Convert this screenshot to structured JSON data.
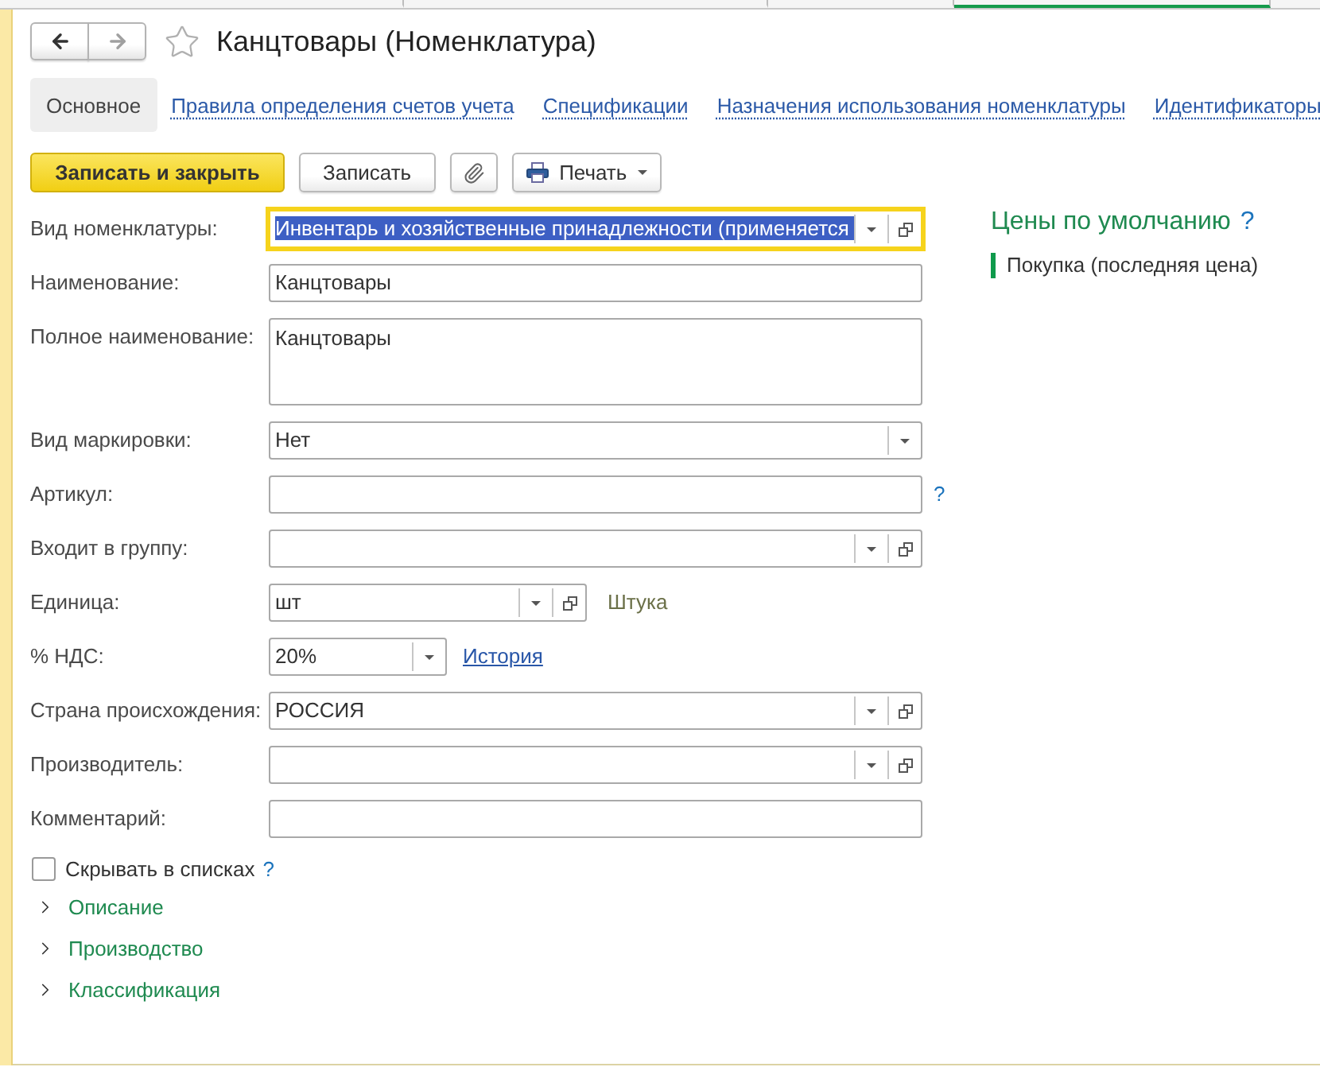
{
  "window_tabs": [
    {
      "selected": false
    },
    {
      "selected": false
    },
    {
      "selected": false
    },
    {
      "selected": true
    }
  ],
  "header": {
    "back_disabled": false,
    "forward_disabled": true,
    "favorite": false,
    "title": "Канцтовары (Номенклатура)"
  },
  "tabs": [
    {
      "label": "Основное",
      "selected": true
    },
    {
      "label": "Правила определения счетов учета",
      "selected": false
    },
    {
      "label": "Спецификации",
      "selected": false
    },
    {
      "label": "Назначения использования номенклатуры",
      "selected": false
    },
    {
      "label": "Идентификаторы",
      "selected": false
    }
  ],
  "toolbar": [
    {
      "kind": "primary",
      "label": "Записать и закрыть"
    },
    {
      "kind": "default",
      "label": "Записать"
    },
    {
      "kind": "attach"
    },
    {
      "kind": "menu",
      "label": "Печать"
    }
  ],
  "fields": [
    {
      "label": "Вид номенклатуры:",
      "kind": "select",
      "value": "Инвентарь и хозяйственные принадлежности (применяется",
      "open_button": true,
      "focused": true
    },
    {
      "label": "Наименование:",
      "kind": "text",
      "value": "Канцтовары",
      "focused": false
    },
    {
      "label": "Полное наименование:",
      "kind": "textarea",
      "value": "Канцтовары",
      "focused": false
    },
    {
      "label": "Вид маркировки:",
      "kind": "select",
      "value": "Нет",
      "open_button": false,
      "focused": false
    },
    {
      "label": "Артикул:",
      "kind": "text",
      "focused": false,
      "help": "?"
    },
    {
      "label": "Входит в группу:",
      "kind": "select",
      "open_button": true,
      "focused": false
    },
    {
      "label": "Единица:",
      "kind": "select",
      "value": "шт",
      "open_button": true,
      "focused": false,
      "note": "Штука"
    },
    {
      "label": "% НДС:",
      "kind": "select",
      "value": "20%",
      "open_button": false,
      "focused": false,
      "link": "История"
    },
    {
      "label": "Страна происхождения:",
      "kind": "select",
      "value": "РОССИЯ",
      "open_button": true,
      "focused": false
    },
    {
      "label": "Производитель:",
      "kind": "select",
      "open_button": true,
      "focused": false
    },
    {
      "label": "Комментарий:",
      "kind": "text",
      "focused": false
    }
  ],
  "checkbox": {
    "label": "Скрывать в списках",
    "checked": false,
    "help": "?"
  },
  "groups": [
    {
      "label": "Описание",
      "expanded": false
    },
    {
      "label": "Производство",
      "expanded": false
    },
    {
      "label": "Классификация",
      "expanded": false
    }
  ],
  "prices": {
    "title": "Цены по умолчанию",
    "help": "?",
    "items": [
      "Покупка (последняя цена)"
    ]
  }
}
